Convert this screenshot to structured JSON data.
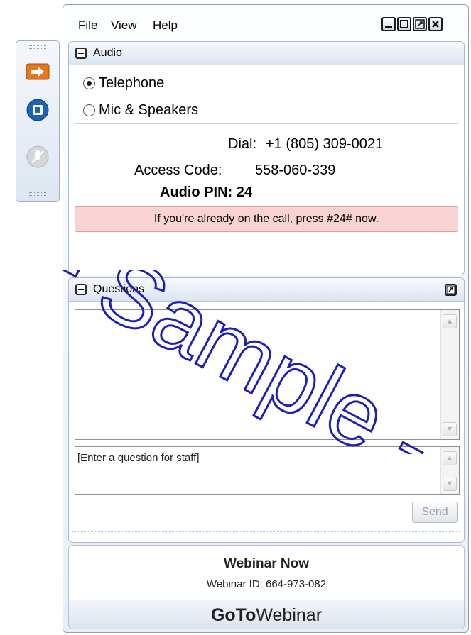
{
  "menu": {
    "file": "File",
    "view": "View",
    "help": "Help"
  },
  "audio": {
    "title": "Audio",
    "options": [
      "Telephone",
      "Mic & Speakers"
    ],
    "selected": "Telephone",
    "dial_label": "Dial:",
    "dial_number": "+1 (805) 309-0021",
    "access_label": "Access Code:",
    "access_code": "558-060-339",
    "pin_text": "Audio PIN: 24",
    "notice": "If you're already on the call, press #24# now."
  },
  "questions": {
    "title": "Questions",
    "input_placeholder": "[Enter a question for staff]",
    "send_label": "Send"
  },
  "footer": {
    "webinar_name": "Webinar Now",
    "webinar_id": "Webinar ID: 664-973-082",
    "brand_bold": "GoTo",
    "brand_light": "Webinar"
  },
  "watermark": "- Sample -",
  "colors": {
    "accent_orange": "#e4761b",
    "accent_blue": "#1b64b4",
    "alert_bg": "#f9d3d3"
  }
}
